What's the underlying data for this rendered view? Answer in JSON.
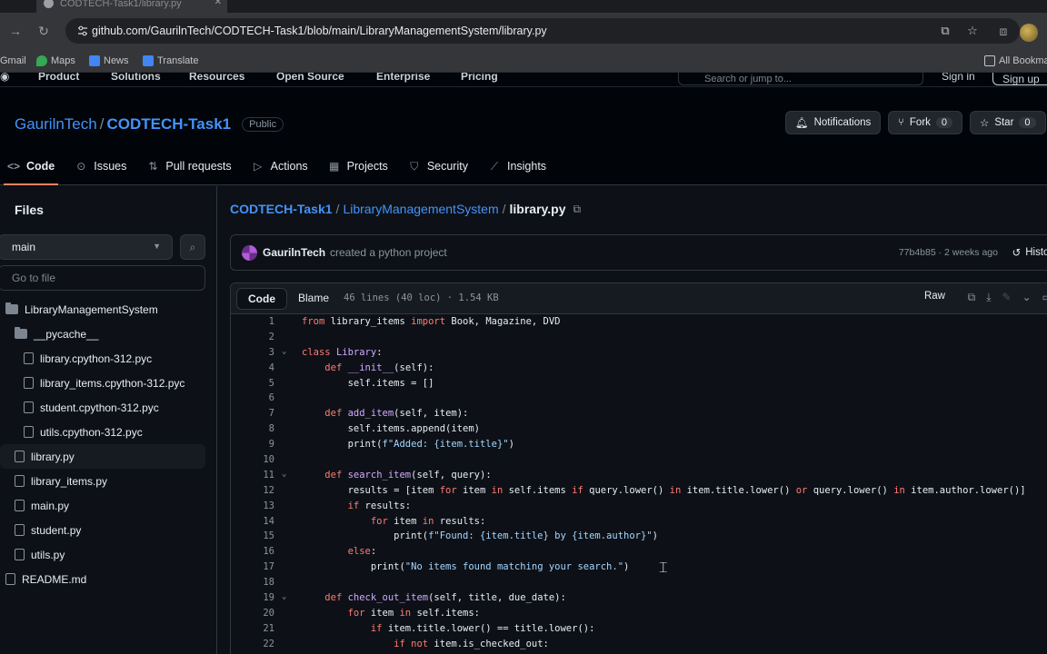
{
  "browser": {
    "tab_title": "CODTECH-Task1/library.py",
    "url": "github.com/GaurilnTech/CODTECH-Task1/blob/main/LibraryManagementSystem/library.py",
    "bookmarks": [
      {
        "label": "Gmail",
        "icon_color": "#ea4335"
      },
      {
        "label": "Maps",
        "icon_color": "#34a853"
      },
      {
        "label": "News",
        "icon_color": "#4285f4"
      },
      {
        "label": "Translate",
        "icon_color": "#4285f4"
      }
    ],
    "all_bookmarks": "All Bookma"
  },
  "gh_header": {
    "menu": [
      "Product",
      "Solutions",
      "Resources",
      "Open Source",
      "Enterprise",
      "Pricing"
    ],
    "search_placeholder": "Search or jump to...",
    "sign_in": "Sign in",
    "sign_up": "Sign up"
  },
  "repo": {
    "owner": "GaurilnTech",
    "separator": "/",
    "name": "CODTECH-Task1",
    "visibility": "Public",
    "notifications_label": "Notifications",
    "fork_label": "Fork",
    "fork_count": "0",
    "star_label": "Star",
    "star_count": "0",
    "tabs": [
      {
        "label": "Code",
        "icon": "code-icon",
        "glyph": "<>"
      },
      {
        "label": "Issues",
        "icon": "issue-icon",
        "glyph": "⊙"
      },
      {
        "label": "Pull requests",
        "icon": "pull-request-icon",
        "glyph": "⇅"
      },
      {
        "label": "Actions",
        "icon": "actions-icon",
        "glyph": "▷"
      },
      {
        "label": "Projects",
        "icon": "projects-icon",
        "glyph": "▦"
      },
      {
        "label": "Security",
        "icon": "shield-icon",
        "glyph": "⛉"
      },
      {
        "label": "Insights",
        "icon": "graph-icon",
        "glyph": "⟋"
      }
    ]
  },
  "sidebar": {
    "title": "Files",
    "branch": "main",
    "goto_placeholder": "Go to file",
    "tree": [
      {
        "label": "LibraryManagementSystem",
        "type": "dir",
        "indent": 0
      },
      {
        "label": "__pycache__",
        "type": "dir",
        "indent": 1
      },
      {
        "label": "library.cpython-312.pyc",
        "type": "file",
        "indent": 2
      },
      {
        "label": "library_items.cpython-312.pyc",
        "type": "file",
        "indent": 2
      },
      {
        "label": "student.cpython-312.pyc",
        "type": "file",
        "indent": 2
      },
      {
        "label": "utils.cpython-312.pyc",
        "type": "file",
        "indent": 2
      },
      {
        "label": "library.py",
        "type": "file",
        "indent": 1,
        "selected": true
      },
      {
        "label": "library_items.py",
        "type": "file",
        "indent": 1
      },
      {
        "label": "main.py",
        "type": "file",
        "indent": 1
      },
      {
        "label": "student.py",
        "type": "file",
        "indent": 1
      },
      {
        "label": "utils.py",
        "type": "file",
        "indent": 1
      },
      {
        "label": "README.md",
        "type": "file",
        "indent": 0
      }
    ]
  },
  "breadcrumb": {
    "repo": "CODTECH-Task1",
    "folder": "LibraryManagementSystem",
    "file": "library.py"
  },
  "commit": {
    "author": "GaurilnTech",
    "message": "created a python project",
    "meta": "77b4b85 · 2 weeks ago",
    "history_label": "History"
  },
  "code_view": {
    "tab_code": "Code",
    "tab_blame": "Blame",
    "file_info": "46 lines (40 loc) · 1.54 KB",
    "raw_label": "Raw",
    "lines": [
      {
        "n": "1",
        "text": "from library_items import Book, Magazine, DVD",
        "fold": ""
      },
      {
        "n": "2",
        "text": "",
        "fold": ""
      },
      {
        "n": "3",
        "text": "class Library:",
        "fold": "⌄"
      },
      {
        "n": "4",
        "text": "    def __init__(self):",
        "fold": ""
      },
      {
        "n": "5",
        "text": "        self.items = []",
        "fold": ""
      },
      {
        "n": "6",
        "text": "",
        "fold": ""
      },
      {
        "n": "7",
        "text": "    def add_item(self, item):",
        "fold": ""
      },
      {
        "n": "8",
        "text": "        self.items.append(item)",
        "fold": ""
      },
      {
        "n": "9",
        "text": "        print(f\"Added: {item.title}\")",
        "fold": ""
      },
      {
        "n": "10",
        "text": "",
        "fold": ""
      },
      {
        "n": "11",
        "text": "    def search_item(self, query):",
        "fold": "⌄"
      },
      {
        "n": "12",
        "text": "        results = [item for item in self.items if query.lower() in item.title.lower() or query.lower() in item.author.lower()]",
        "fold": ""
      },
      {
        "n": "13",
        "text": "        if results:",
        "fold": ""
      },
      {
        "n": "14",
        "text": "            for item in results:",
        "fold": ""
      },
      {
        "n": "15",
        "text": "                print(f\"Found: {item.title} by {item.author}\")",
        "fold": ""
      },
      {
        "n": "16",
        "text": "        else:",
        "fold": ""
      },
      {
        "n": "17",
        "text": "            print(\"No items found matching your search.\")",
        "fold": ""
      },
      {
        "n": "18",
        "text": "",
        "fold": ""
      },
      {
        "n": "19",
        "text": "    def check_out_item(self, title, due_date):",
        "fold": "⌄"
      },
      {
        "n": "20",
        "text": "        for item in self.items:",
        "fold": ""
      },
      {
        "n": "21",
        "text": "            if item.title.lower() == title.lower():",
        "fold": ""
      },
      {
        "n": "22",
        "text": "                if not item.is_checked_out:",
        "fold": ""
      }
    ]
  }
}
